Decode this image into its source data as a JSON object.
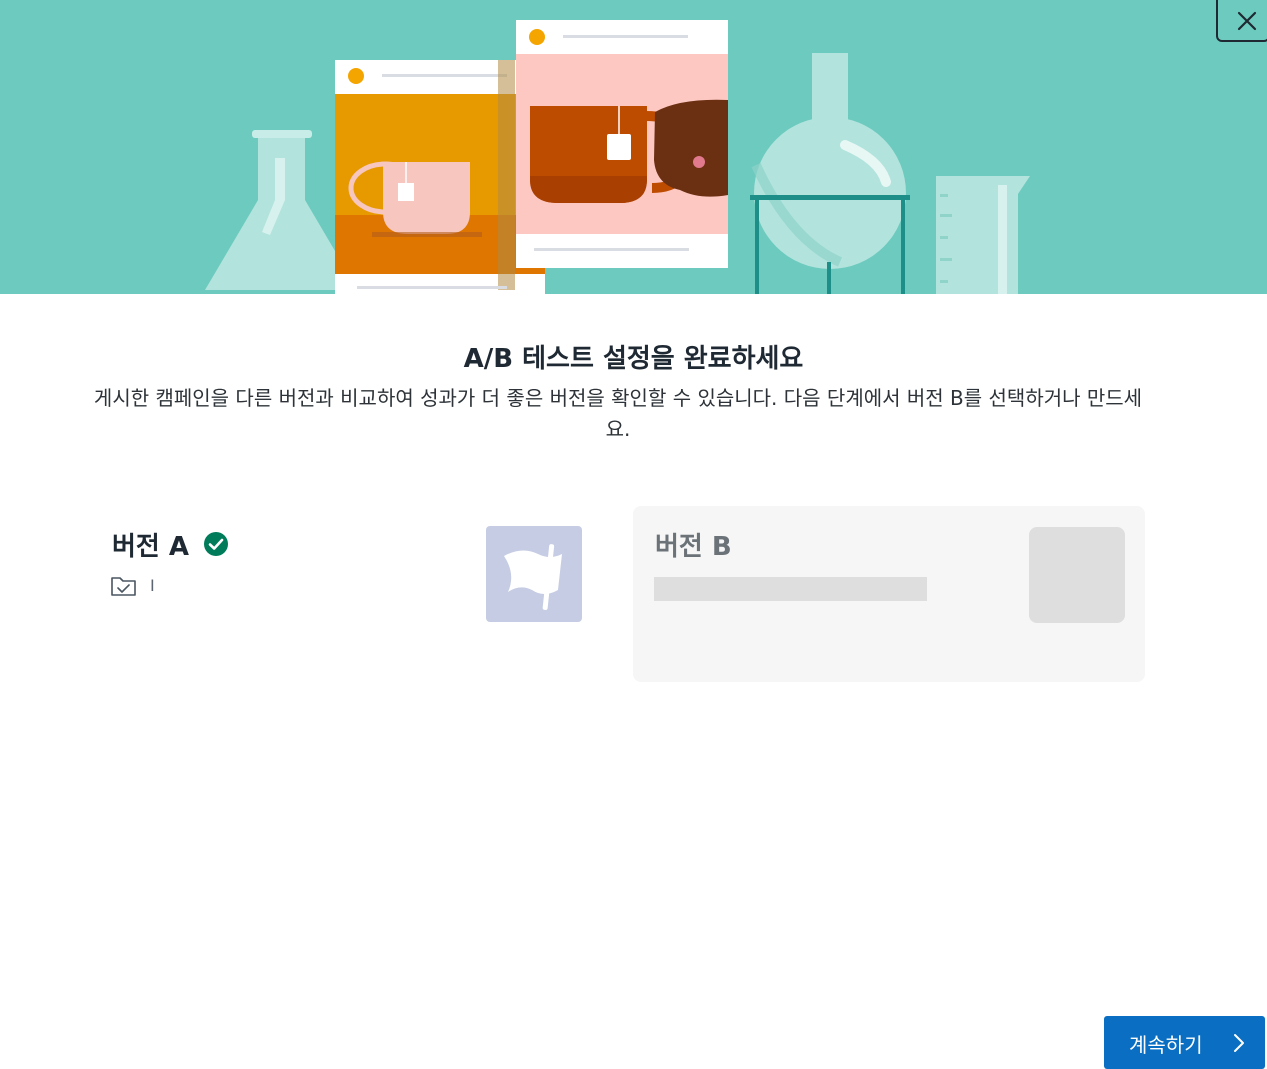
{
  "hero": {
    "illustration": "ab-test-lab-illustration",
    "close_icon": "close-icon"
  },
  "dialog": {
    "title": "A/B 테스트 설정을 완료하세요",
    "description": "게시한 캠페인을 다른 버전과 비교하여 성과가 더 좋은 버전을 확인할 수 있습니다. 다음 단계에서 버전 B를 선택하거나 만드세요."
  },
  "version_a": {
    "label": "버전 A",
    "status_icon": "check-circle-icon",
    "folder_icon": "folder-check-icon",
    "campaign_name": "I",
    "thumbnail_icon": "flag-icon"
  },
  "version_b": {
    "label": "버전 B",
    "placeholder": "loading-skeleton"
  },
  "footer": {
    "continue_label": "계속하기",
    "continue_icon": "chevron-right-icon"
  },
  "colors": {
    "hero_bg": "#6ccabe",
    "primary_button": "#0a6fc2",
    "check": "#007c5a",
    "thumb_a": "#c5cce3"
  }
}
